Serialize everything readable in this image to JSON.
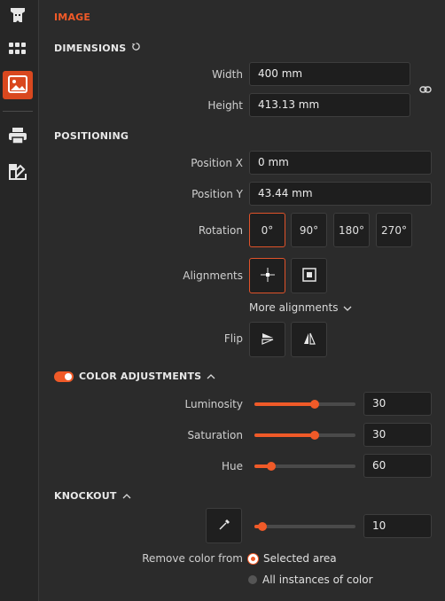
{
  "sidebar": {
    "items": [
      "text-icon",
      "grid-icon",
      "image-icon",
      "printer-icon",
      "swatch-icon"
    ],
    "active": "image-icon"
  },
  "image_section": {
    "title": "IMAGE"
  },
  "dimensions": {
    "title": "DIMENSIONS",
    "width_label": "Width",
    "width_value": "400 mm",
    "height_label": "Height",
    "height_value": "413.13 mm"
  },
  "positioning": {
    "title": "POSITIONING",
    "posx_label": "Position X",
    "posx_value": "0 mm",
    "posy_label": "Position Y",
    "posy_value": "43.44 mm",
    "rotation_label": "Rotation",
    "rotations": [
      "0°",
      "90°",
      "180°",
      "270°"
    ],
    "rotation_selected": "0°",
    "alignments_label": "Alignments",
    "more_alignments": "More alignments",
    "flip_label": "Flip"
  },
  "color_adjustments": {
    "title": "COLOR ADJUSTMENTS",
    "enabled": true,
    "luminosity_label": "Luminosity",
    "luminosity_value": "30",
    "luminosity_level": 0.6,
    "saturation_label": "Saturation",
    "saturation_value": "30",
    "saturation_level": 0.6,
    "hue_label": "Hue",
    "hue_value": "60",
    "hue_level": 0.17
  },
  "knockout": {
    "title": "KNOCKOUT",
    "tolerance_value": "10",
    "tolerance_level": 0.08,
    "remove_color_label": "Remove color from",
    "options": [
      "Selected area",
      "All instances of color"
    ],
    "selected_option": "Selected area"
  },
  "colors": {
    "accent": "#f05a28",
    "background": "#2b2b2b",
    "field": "#1e1e1e"
  }
}
